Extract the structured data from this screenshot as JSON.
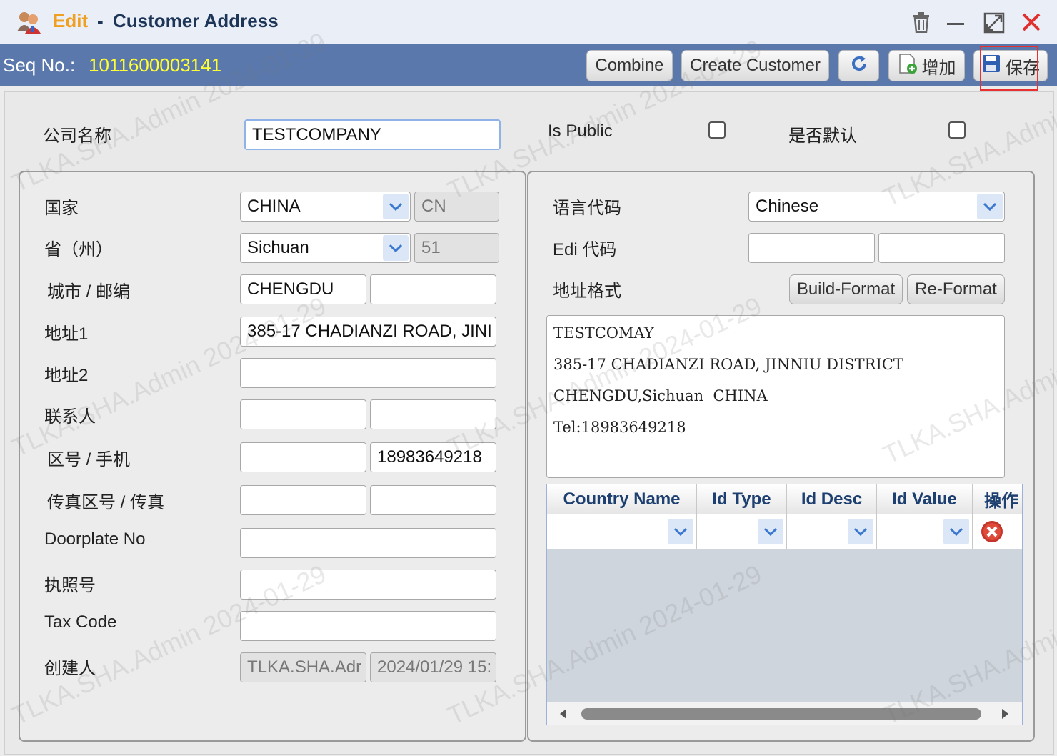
{
  "window": {
    "title_prefix": "Edit",
    "title_sep": "-",
    "title": "Customer Address",
    "icons": [
      "users-icon",
      "trash-icon",
      "minimize-icon",
      "maximize-icon",
      "close-icon"
    ]
  },
  "toolbar": {
    "seq_label": "Seq No.:",
    "seq_value": "1011600003141",
    "combine": "Combine",
    "create_customer": "Create Customer",
    "add": "增加",
    "save": "保存"
  },
  "header": {
    "company_label": "公司名称",
    "company_value": "TESTCOMPANY",
    "is_public_label": "Is Public",
    "is_default_label": "是否默认"
  },
  "left": {
    "country_label": "国家",
    "country_value": "CHINA",
    "country_code": "CN",
    "province_label": "省（州）",
    "province_value": "Sichuan",
    "province_code": "51",
    "city_label": "城市 / 邮编",
    "city_value": "CHENGDU",
    "zip_value": "",
    "addr1_label": "地址1",
    "addr1_value": "385-17 CHADIANZI ROAD, JINI",
    "addr2_label": "地址2",
    "contact_label": "联系人",
    "phone_label": "区号 / 手机",
    "mobile_value": "18983649218",
    "fax_label": "传真区号 / 传真",
    "doorplate_label": "Doorplate No",
    "license_label": "执照号",
    "tax_label": "Tax Code",
    "creator_label": "创建人",
    "creator_value": "TLKA.SHA.Adr",
    "created_value": "2024/01/29 15:"
  },
  "right": {
    "lang_label": "语言代码",
    "lang_value": "Chinese",
    "edi_label": "Edi 代码",
    "format_label": "地址格式",
    "build_format": "Build-Format",
    "re_format": "Re-Format",
    "address_lines": [
      "TESTCOMAY",
      "385-17 CHADIANZI ROAD, JINNIU DISTRICT",
      "CHENGDU,Sichuan  CHINA",
      "Tel:18983649218"
    ]
  },
  "grid": {
    "columns": [
      "Country Name",
      "Id Type",
      "Id Desc",
      "Id Value",
      "操作"
    ]
  },
  "watermark": "TLKA.SHA.Admin 2024-01-29"
}
